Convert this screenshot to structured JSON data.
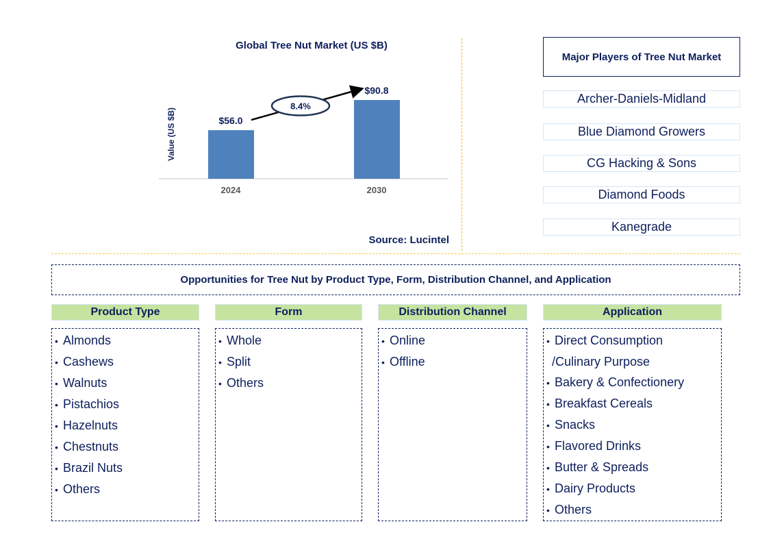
{
  "chart_data": {
    "type": "bar",
    "title": "Global Tree Nut Market (US $B)",
    "xlabel": "",
    "ylabel": "Value (US $B)",
    "categories": [
      "2024",
      "2030"
    ],
    "values": [
      56.0,
      90.8
    ],
    "data_labels": [
      "$56.0",
      "$90.8"
    ],
    "ylim": [
      0,
      100
    ],
    "grid": false,
    "annotation": {
      "type": "cagr-arrow",
      "label": "8.4%",
      "from": "2024",
      "to": "2030"
    },
    "bar_color": "#4f81bd",
    "source": "Source: Lucintel"
  },
  "players": {
    "title": "Major Players of Tree Nut Market",
    "items": [
      "Archer-Daniels-Midland",
      "Blue Diamond Growers",
      "CG Hacking & Sons",
      "Diamond Foods",
      "Kanegrade"
    ]
  },
  "opportunities": {
    "title": "Opportunities for Tree Nut by Product Type, Form, Distribution Channel, and Application",
    "segments": [
      {
        "header": "Product Type",
        "items": [
          "Almonds",
          "Cashews",
          "Walnuts",
          "Pistachios",
          "Hazelnuts",
          "Chestnuts",
          "Brazil Nuts",
          "Others"
        ]
      },
      {
        "header": "Form",
        "items": [
          "Whole",
          "Split",
          "Others"
        ]
      },
      {
        "header": "Distribution Channel",
        "items": [
          "Online",
          "Offline"
        ]
      },
      {
        "header": "Application",
        "items": [
          "Direct Consumption",
          "/Culinary Purpose",
          "Bakery & Confectionery",
          "Breakfast Cereals",
          "Snacks",
          "Flavored Drinks",
          "Butter & Spreads",
          "Dairy Products",
          "Others"
        ]
      }
    ]
  },
  "colors": {
    "text": "#0d1f5c",
    "bar": "#4f81bd",
    "divider": "#f5b800",
    "segment_header_bg": "#c6e3a0",
    "player_border": "#d3e6f5"
  }
}
